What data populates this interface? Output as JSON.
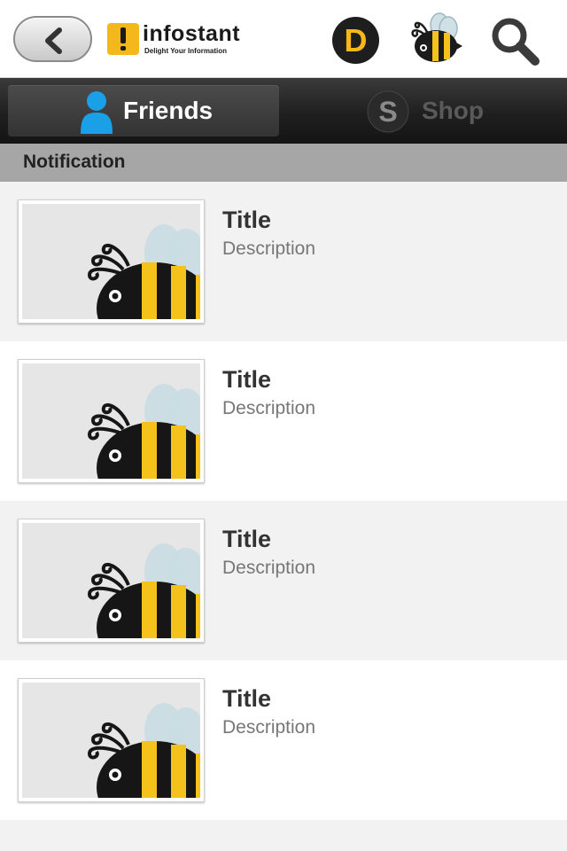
{
  "header": {
    "back_icon": "chevron-left-icon",
    "logo_name": "infostant",
    "logo_tagline": "Delight Your Information",
    "d_icon_letter": "D",
    "bee_icon": "bee-icon",
    "search_icon": "search-icon",
    "accent_color": "#f5b81c"
  },
  "tabs": [
    {
      "label": "Friends",
      "icon": "person-icon",
      "active": true
    },
    {
      "label": "Shop",
      "icon": "shop-s-icon",
      "active": false
    }
  ],
  "section": {
    "title": "Notification"
  },
  "items": [
    {
      "title": "Title",
      "description": "Description",
      "thumbnail": "bee-thumbnail"
    },
    {
      "title": "Title",
      "description": "Description",
      "thumbnail": "bee-thumbnail"
    },
    {
      "title": "Title",
      "description": "Description",
      "thumbnail": "bee-thumbnail"
    },
    {
      "title": "Title",
      "description": "Description",
      "thumbnail": "bee-thumbnail"
    }
  ]
}
